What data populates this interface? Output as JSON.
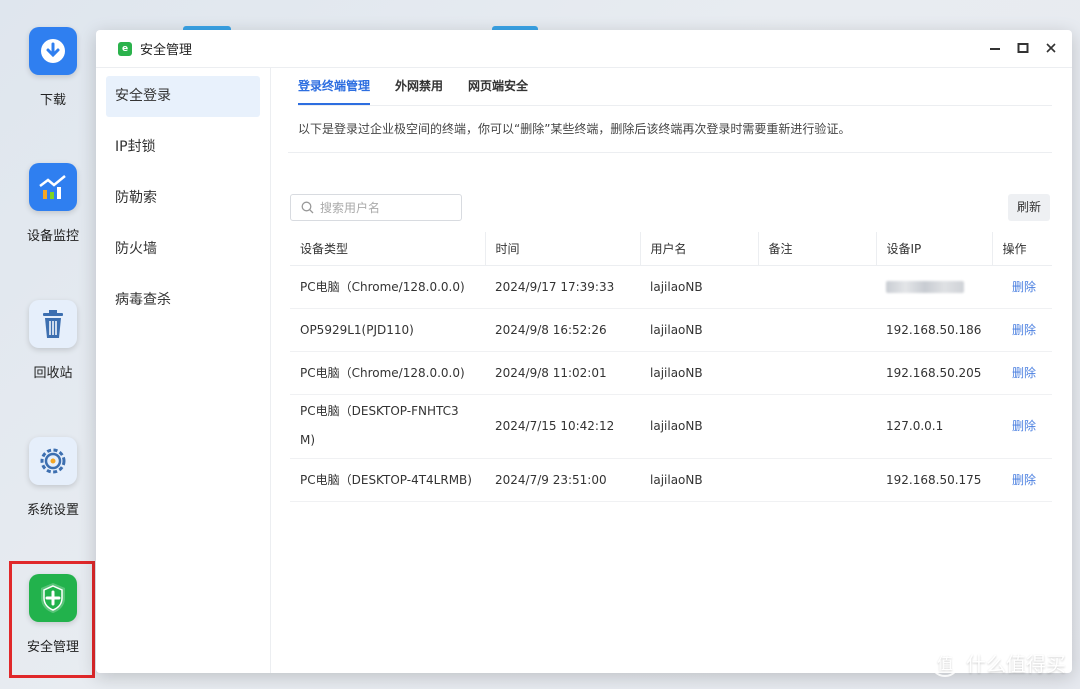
{
  "desktop": {
    "icons": [
      {
        "label": "下载",
        "icon": "download-icon",
        "color": "#2f7ff0"
      },
      {
        "label": "设备监控",
        "icon": "monitor-chart-icon",
        "color": "#2f7ff0"
      },
      {
        "label": "回收站",
        "icon": "trash-icon",
        "color": "#4a7fe0"
      },
      {
        "label": "系统设置",
        "icon": "gear-icon",
        "color": "#3d6fb0"
      },
      {
        "label": "安全管理",
        "icon": "shield-plus-icon",
        "color": "#22b24c"
      }
    ]
  },
  "window": {
    "title": "安全管理",
    "controls": {
      "minimize": "minimize-icon",
      "maximize": "maximize-icon",
      "close": "close-icon"
    }
  },
  "sidebar": {
    "items": [
      {
        "label": "安全登录",
        "active": true
      },
      {
        "label": "IP封锁"
      },
      {
        "label": "防勒索"
      },
      {
        "label": "防火墙"
      },
      {
        "label": "病毒查杀"
      }
    ]
  },
  "tabs": [
    {
      "label": "登录终端管理",
      "active": true
    },
    {
      "label": "外网禁用"
    },
    {
      "label": "网页端安全"
    }
  ],
  "description": "以下是登录过企业极空间的终端，你可以“删除”某些终端，删除后该终端再次登录时需要重新进行验证。",
  "search": {
    "placeholder": "搜索用户名",
    "value": ""
  },
  "refresh_label": "刷新",
  "table": {
    "columns": [
      "设备类型",
      "时间",
      "用户名",
      "备注",
      "设备IP",
      "操作"
    ],
    "rows": [
      {
        "device": "PC电脑（Chrome/128.0.0.0)",
        "time": "2024/9/17 17:39:33",
        "user": "lajilaoNB",
        "note": "",
        "ip": "",
        "ip_blurred": true,
        "action": "删除"
      },
      {
        "device": "OP5929L1(PJD110)",
        "time": "2024/9/8 16:52:26",
        "user": "lajilaoNB",
        "note": "",
        "ip": "192.168.50.186",
        "action": "删除"
      },
      {
        "device": "PC电脑（Chrome/128.0.0.0)",
        "time": "2024/9/8 11:02:01",
        "user": "lajilaoNB",
        "note": "",
        "ip": "192.168.50.205",
        "action": "删除"
      },
      {
        "device_line1": "PC电脑（DESKTOP-FNHTC3",
        "device_line2": "M)",
        "time": "2024/7/15 10:42:12",
        "user": "lajilaoNB",
        "note": "",
        "ip": "127.0.0.1",
        "action": "删除"
      },
      {
        "device": "PC电脑（DESKTOP-4T4LRMB)",
        "time": "2024/7/9 23:51:00",
        "user": "lajilaoNB",
        "note": "",
        "ip": "192.168.50.175",
        "action": "删除"
      }
    ]
  },
  "watermark": {
    "text": "什么值得买",
    "glyph": "值"
  }
}
